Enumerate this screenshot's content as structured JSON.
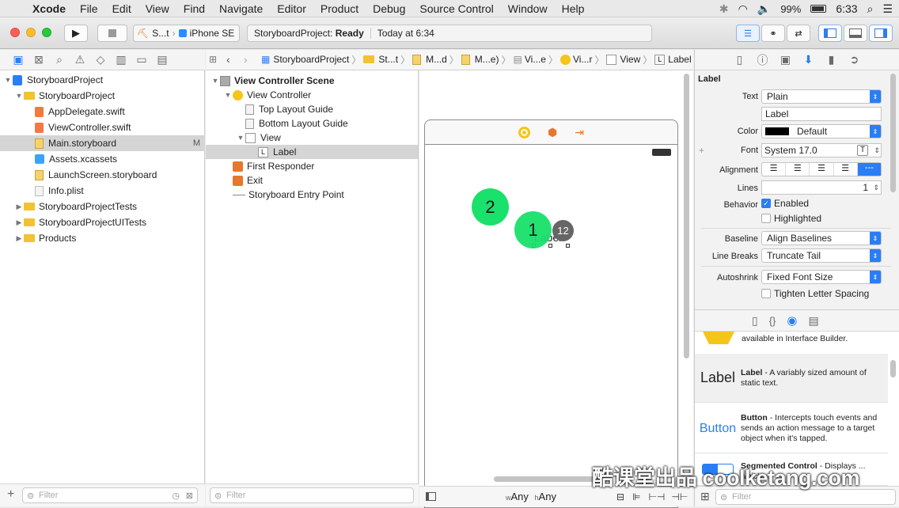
{
  "menubar": {
    "app": "Xcode",
    "items": [
      "File",
      "Edit",
      "View",
      "Find",
      "Navigate",
      "Editor",
      "Product",
      "Debug",
      "Source Control",
      "Window",
      "Help"
    ],
    "battery": "99%",
    "time": "6:33"
  },
  "toolbar": {
    "scheme_target": "S...t",
    "device": "iPhone SE",
    "status_project": "StoryboardProject:",
    "status_state": "Ready",
    "status_time": "Today at 6:34"
  },
  "navigator": {
    "items": [
      {
        "label": "StoryboardProject",
        "level": 0,
        "kind": "project",
        "open": true
      },
      {
        "label": "StoryboardProject",
        "level": 1,
        "kind": "folder",
        "open": true
      },
      {
        "label": "AppDelegate.swift",
        "level": 2,
        "kind": "swift"
      },
      {
        "label": "ViewController.swift",
        "level": 2,
        "kind": "swift"
      },
      {
        "label": "Main.storyboard",
        "level": 2,
        "kind": "storyboard",
        "badge": "M",
        "selected": true
      },
      {
        "label": "Assets.xcassets",
        "level": 2,
        "kind": "assets"
      },
      {
        "label": "LaunchScreen.storyboard",
        "level": 2,
        "kind": "storyboard"
      },
      {
        "label": "Info.plist",
        "level": 2,
        "kind": "file"
      },
      {
        "label": "StoryboardProjectTests",
        "level": 1,
        "kind": "folder",
        "open": false
      },
      {
        "label": "StoryboardProjectUITests",
        "level": 1,
        "kind": "folder",
        "open": false
      },
      {
        "label": "Products",
        "level": 1,
        "kind": "folder",
        "open": false
      }
    ],
    "filter_placeholder": "Filter"
  },
  "jumpbar": {
    "items": [
      "StoryboardProject",
      "St...t",
      "M...d",
      "M...e)",
      "Vi...e",
      "Vi...r",
      "View",
      "Label"
    ]
  },
  "outline": {
    "items": [
      {
        "label": "View Controller Scene",
        "level": 0,
        "bold": true
      },
      {
        "label": "View Controller",
        "level": 1
      },
      {
        "label": "Top Layout Guide",
        "level": 2
      },
      {
        "label": "Bottom Layout Guide",
        "level": 2
      },
      {
        "label": "View",
        "level": 2
      },
      {
        "label": "Label",
        "level": 3,
        "selected": true
      },
      {
        "label": "First Responder",
        "level": 1
      },
      {
        "label": "Exit",
        "level": 1
      },
      {
        "label": "Storyboard Entry Point",
        "level": 1
      }
    ],
    "filter_placeholder": "Filter"
  },
  "canvas": {
    "label_text": "Label",
    "touch_1": "1",
    "touch_2": "2",
    "touch_count": "12",
    "size_w": "w",
    "size_w_val": "Any",
    "size_h": "h",
    "size_h_val": "Any"
  },
  "inspector": {
    "section": "Label",
    "text_label": "Text",
    "text_value": "Plain",
    "text_content": "Label",
    "color_label": "Color",
    "color_value": "Default",
    "font_label": "Font",
    "font_value": "System 17.0",
    "alignment_label": "Alignment",
    "lines_label": "Lines",
    "lines_value": "1",
    "behavior_label": "Behavior",
    "enabled": "Enabled",
    "highlighted": "Highlighted",
    "baseline_label": "Baseline",
    "baseline_value": "Align Baselines",
    "linebreaks_label": "Line Breaks",
    "linebreaks_value": "Truncate Tail",
    "autoshrink_label": "Autoshrink",
    "autoshrink_value": "Fixed Font Size",
    "tighten": "Tighten Letter Spacing"
  },
  "library": {
    "top_text": "available in Interface Builder.",
    "items": [
      {
        "preview": "Label",
        "title": "Label",
        "desc": " - A variably sized amount of static text."
      },
      {
        "preview": "Button",
        "title": "Button",
        "desc": " - Intercepts touch events and sends an action message to a target object when it's tapped."
      },
      {
        "preview": "",
        "title": "Segmented Control",
        "desc": " - Displays ... which"
      }
    ],
    "filter_placeholder": "Filter"
  },
  "watermark": "酷课堂出品 coolketang.com",
  "colors": {
    "touch": "#19e16b",
    "selection_blue": "#2a7ef5"
  }
}
